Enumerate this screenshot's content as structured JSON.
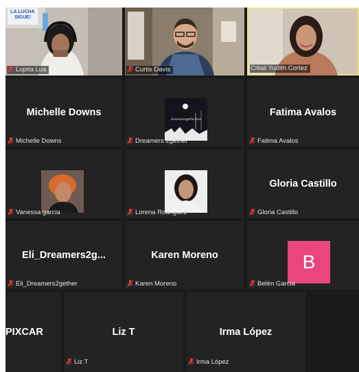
{
  "participants": [
    {
      "id": "lupita",
      "display_name": "",
      "label": "Lupita Lua",
      "video": true,
      "sign_text": "LA LUCHA SIGUE!"
    },
    {
      "id": "curtis",
      "display_name": "",
      "label": "Curtis Davis",
      "video": true
    },
    {
      "id": "citlali",
      "display_name": "",
      "label": "Citlali Yudith Cortez",
      "video": true,
      "active_speaker": true
    },
    {
      "id": "michelle",
      "display_name": "Michelle Downs",
      "label": "Michelle Downs",
      "video": false
    },
    {
      "id": "dreamers",
      "display_name": "",
      "label": "Dreamers 2gether",
      "video": false,
      "picture": true,
      "picture_text": "Dreamers2gether.love"
    },
    {
      "id": "fatima",
      "display_name": "Fatima Avalos",
      "label": "Fatima Avalos",
      "video": false
    },
    {
      "id": "vanessa",
      "display_name": "",
      "label": "Vanessa garcia",
      "video": false,
      "picture": true
    },
    {
      "id": "lorena",
      "display_name": "",
      "label": "Lorena Rodriguez",
      "video": false,
      "picture": true
    },
    {
      "id": "gloria",
      "display_name": "Gloria Castillo",
      "label": "Gloria Castillo",
      "video": false
    },
    {
      "id": "eli",
      "display_name": "Eli_Dreamers2g...",
      "label": "Eli_Dreamers2gether",
      "video": false
    },
    {
      "id": "karen",
      "display_name": "Karen Moreno",
      "label": "Karen Moreno",
      "video": false
    },
    {
      "id": "belen",
      "display_name": "",
      "label": "Belén Garcia",
      "video": false,
      "avatar_letter": "B"
    },
    {
      "id": "pixcar",
      "display_name": "PIXCAR",
      "label": "",
      "video": false
    },
    {
      "id": "liz",
      "display_name": "Liz T",
      "label": "Liz T",
      "video": false
    },
    {
      "id": "irma",
      "display_name": "Irma López",
      "label": "Irma López",
      "video": false
    }
  ],
  "colors": {
    "background": "#1a1a1a",
    "tile": "#232323",
    "active_border": "#e9e48a",
    "muted_mic": "#e03c3c",
    "avatar_b": "#e8467c"
  }
}
